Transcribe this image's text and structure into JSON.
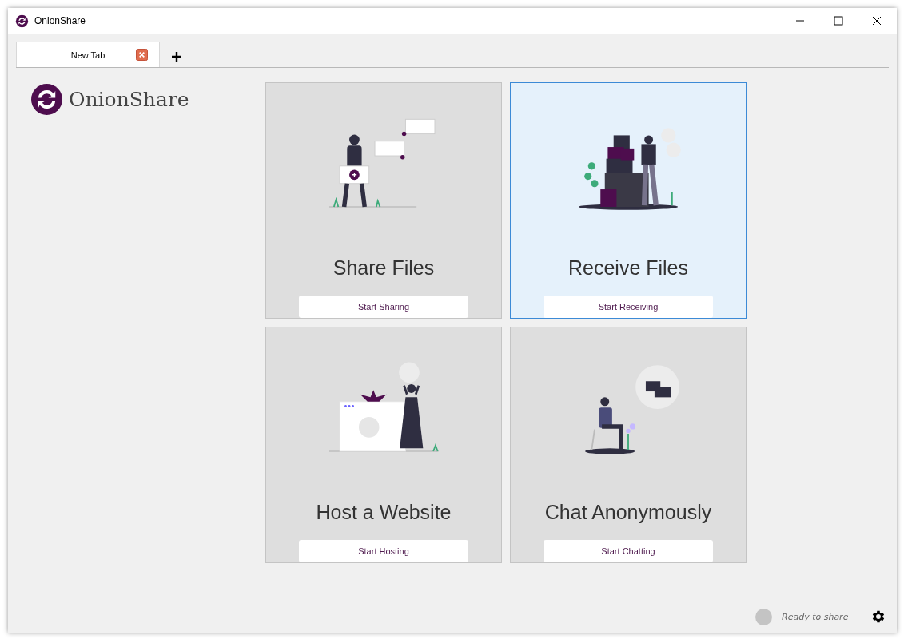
{
  "window": {
    "title": "OnionShare"
  },
  "tabs": [
    {
      "label": "New Tab",
      "selected": true
    }
  ],
  "logo": {
    "text": "OnionShare"
  },
  "modes": [
    {
      "kind": "share",
      "title": "Share Files",
      "button": "Start Sharing",
      "highlighted": false
    },
    {
      "kind": "receive",
      "title": "Receive Files",
      "button": "Start Receiving",
      "highlighted": true
    },
    {
      "kind": "website",
      "title": "Host a Website",
      "button": "Start Hosting",
      "highlighted": false
    },
    {
      "kind": "chat",
      "title": "Chat Anonymously",
      "button": "Start Chatting",
      "highlighted": false
    }
  ],
  "status_bar": {
    "text": "Ready to share"
  }
}
